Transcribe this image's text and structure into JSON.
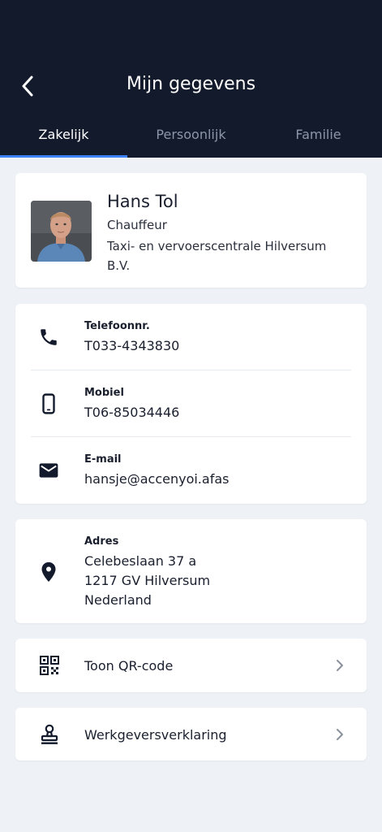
{
  "header": {
    "title": "Mijn gegevens",
    "back_icon": "chevron-left-icon"
  },
  "tabs": [
    {
      "label": "Zakelijk",
      "active": true
    },
    {
      "label": "Persoonlijk",
      "active": false
    },
    {
      "label": "Familie",
      "active": false
    }
  ],
  "profile": {
    "name": "Hans Tol",
    "role": "Chauffeur",
    "company": "Taxi- en vervoerscentrale Hilversum B.V."
  },
  "contact": [
    {
      "label": "Telefoonnr.",
      "value": "T033-4343830",
      "icon": "phone-icon"
    },
    {
      "label": "Mobiel",
      "value": "T06-85034446",
      "icon": "mobile-icon"
    },
    {
      "label": "E-mail",
      "value": "hansje@accenyoi.afas",
      "icon": "mail-icon"
    }
  ],
  "address": {
    "label": "Adres",
    "lines": [
      "Celebeslaan 37 a",
      "1217 GV Hilversum",
      "Nederland"
    ],
    "icon": "location-pin-icon"
  },
  "links": [
    {
      "label": "Toon QR-code",
      "icon": "qr-code-icon"
    },
    {
      "label": "Werkgeversverklaring",
      "icon": "stamp-icon"
    }
  ],
  "colors": {
    "header": "#121a2c",
    "accent": "#3b82f6",
    "background": "#eef2f7"
  }
}
